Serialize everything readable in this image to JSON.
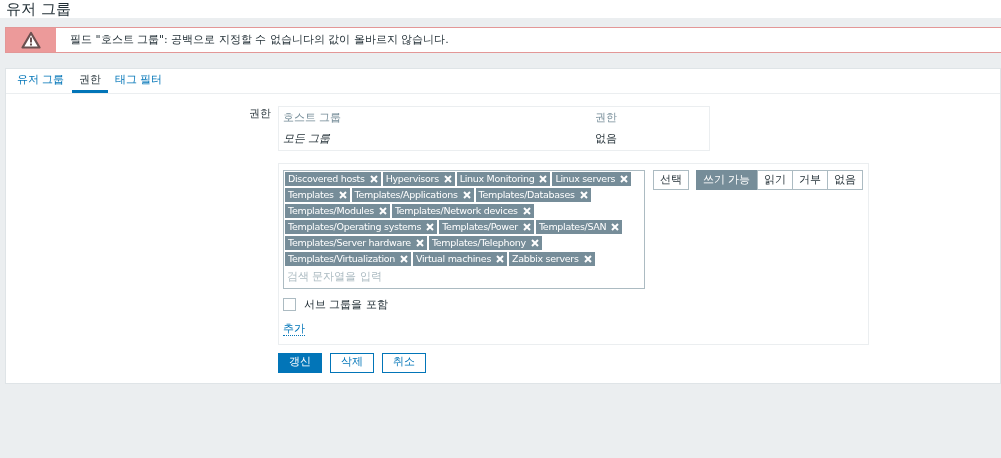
{
  "title": "유저 그룹",
  "alert": {
    "message": "필드 \"호스트 그룹\": 공백으로 지정할 수 없습니다의 값이 올바르지 않습니다."
  },
  "tabs": [
    {
      "label": "유저 그룹",
      "selected": false
    },
    {
      "label": "권한",
      "selected": true
    },
    {
      "label": "태그 필터",
      "selected": false
    }
  ],
  "permissions": {
    "label": "권한",
    "columns": [
      "호스트 그룹",
      "권한"
    ],
    "rows": [
      [
        "모든 그룹",
        "없음"
      ]
    ]
  },
  "host_groups": [
    {
      "name": "Discovered hosts"
    },
    {
      "name": "Hypervisors"
    },
    {
      "name": "Linux Monitoring"
    },
    {
      "name": "Linux servers"
    },
    {
      "name": "Templates"
    },
    {
      "name": "Templates/Applications"
    },
    {
      "name": "Templates/Databases"
    },
    {
      "name": "Templates/Modules"
    },
    {
      "name": "Templates/Network devices"
    },
    {
      "name": "Templates/Operating systems"
    },
    {
      "name": "Templates/Power"
    },
    {
      "name": "Templates/SAN"
    },
    {
      "name": "Templates/Server hardware"
    },
    {
      "name": "Templates/Telephony"
    },
    {
      "name": "Templates/Virtualization"
    },
    {
      "name": "Virtual machines"
    },
    {
      "name": "Zabbix servers"
    }
  ],
  "search_placeholder": "검색 문자열을 입력",
  "select_button": "선택",
  "permission_options": [
    {
      "label": "쓰기 가능",
      "selected": true
    },
    {
      "label": "읽기",
      "selected": false
    },
    {
      "label": "거부",
      "selected": false
    },
    {
      "label": "없음",
      "selected": false
    }
  ],
  "include_subgroups": {
    "label": "서브 그룹을 포함",
    "checked": false
  },
  "add_link": "추가",
  "buttons": [
    {
      "label": "갱신",
      "kind": "primary"
    },
    {
      "label": "삭제",
      "kind": "outline"
    },
    {
      "label": "취소",
      "kind": "outline"
    }
  ]
}
